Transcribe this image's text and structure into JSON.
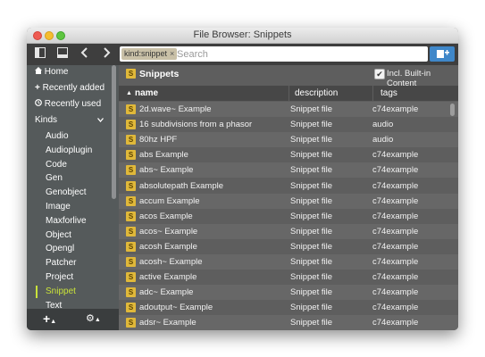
{
  "window": {
    "title": "File Browser: Snippets"
  },
  "toolbar": {
    "search": {
      "chip": "kind:snippet",
      "chip_close": "×",
      "placeholder": "Search",
      "value": ""
    },
    "icons": [
      "sidebar-toggle-icon",
      "panel-toggle-icon",
      "back-arrow-icon",
      "forward-arrow-icon",
      "add-to-collection-icon"
    ]
  },
  "sidebar": {
    "home": "Home",
    "recently_added": "Recently added",
    "recently_used": "Recently used",
    "kinds_label": "Kinds",
    "kinds": [
      "Audio",
      "Audioplugin",
      "Code",
      "Gen",
      "Genobject",
      "Image",
      "Maxforlive",
      "Object",
      "Opengl",
      "Patcher",
      "Project",
      "Snippet",
      "Text"
    ],
    "selected_kind": "Snippet",
    "accent": "#c9e23a"
  },
  "main": {
    "section_title": "Snippets",
    "include_builtin": "Incl. Built-in Content",
    "include_builtin_checked": true,
    "snippet_icon_letter": "S",
    "columns": {
      "name": "name",
      "description": "description",
      "tags": "tags"
    },
    "rows": [
      {
        "name": "2d.wave~ Example",
        "description": "Snippet file",
        "tags": "c74example"
      },
      {
        "name": "16 subdivisions from a phasor",
        "description": "Snippet file",
        "tags": "audio"
      },
      {
        "name": "80hz HPF",
        "description": "Snippet file",
        "tags": "audio"
      },
      {
        "name": "abs Example",
        "description": "Snippet file",
        "tags": "c74example"
      },
      {
        "name": "abs~ Example",
        "description": "Snippet file",
        "tags": "c74example"
      },
      {
        "name": "absolutepath Example",
        "description": "Snippet file",
        "tags": "c74example"
      },
      {
        "name": "accum Example",
        "description": "Snippet file",
        "tags": "c74example"
      },
      {
        "name": "acos Example",
        "description": "Snippet file",
        "tags": "c74example"
      },
      {
        "name": "acos~ Example",
        "description": "Snippet file",
        "tags": "c74example"
      },
      {
        "name": "acosh Example",
        "description": "Snippet file",
        "tags": "c74example"
      },
      {
        "name": "acosh~ Example",
        "description": "Snippet file",
        "tags": "c74example"
      },
      {
        "name": "active Example",
        "description": "Snippet file",
        "tags": "c74example"
      },
      {
        "name": "adc~ Example",
        "description": "Snippet file",
        "tags": "c74example"
      },
      {
        "name": "adoutput~ Example",
        "description": "Snippet file",
        "tags": "c74example"
      },
      {
        "name": "adsr~ Example",
        "description": "Snippet file",
        "tags": "c74example"
      }
    ]
  },
  "colors": {
    "snippet_icon": "#e0b83a",
    "search_button": "#3f87c9"
  }
}
